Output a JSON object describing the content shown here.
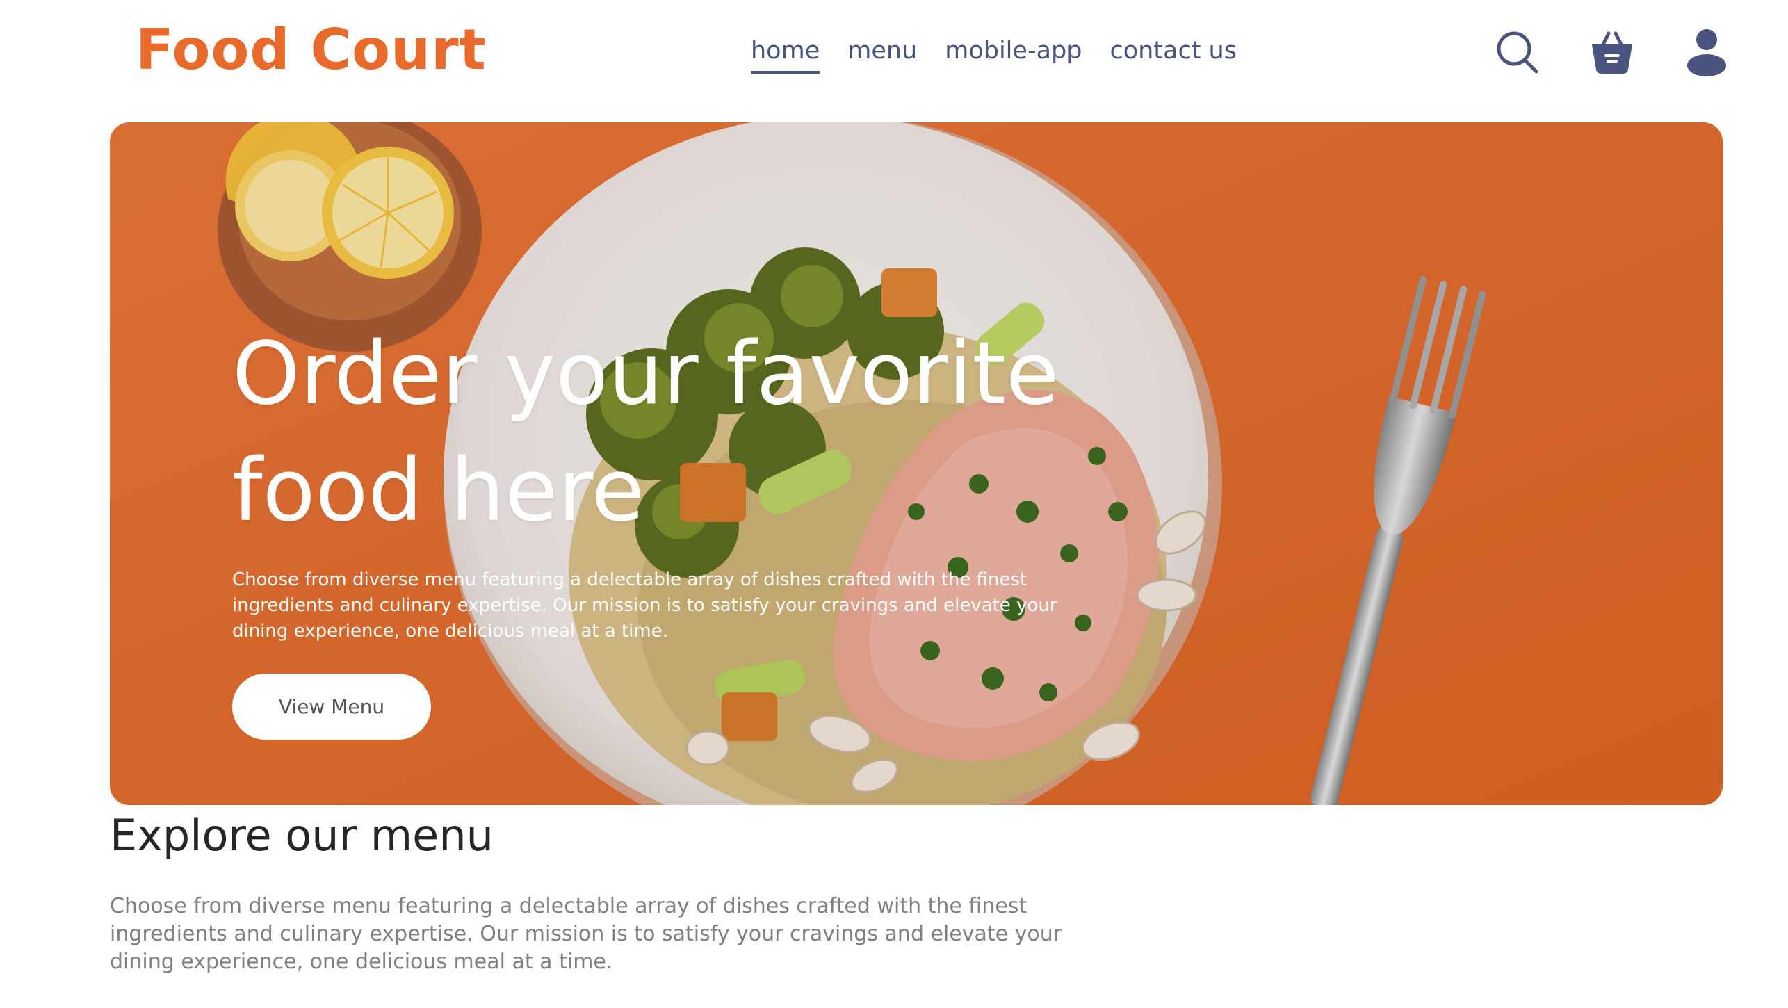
{
  "navbar": {
    "logo": "Food Court",
    "links": [
      {
        "label": "home",
        "active": true
      },
      {
        "label": "menu",
        "active": false
      },
      {
        "label": "mobile-app",
        "active": false
      },
      {
        "label": "contact us",
        "active": false
      }
    ],
    "icons": [
      "search-icon",
      "basket-icon",
      "profile-icon"
    ]
  },
  "hero": {
    "title": "Order your favorite food here",
    "text": "Choose from diverse menu featuring a delectable array of dishes crafted with the finest ingredients and culinary expertise. Our mission is to satisfy your cravings and elevate your dining experience, one delicious meal at a time.",
    "button_label": "View Menu"
  },
  "explore": {
    "title": "Explore our menu",
    "text": "Choose from diverse menu featuring a delectable array of dishes crafted with the finest ingredients and culinary expertise. Our mission is to satisfy your cravings and elevate your dining experience, one delicious meal at a time."
  },
  "colors": {
    "brand": "#e8692a",
    "nav_text": "#49557e",
    "hero_bg": "#e26a32",
    "heading": "#262626",
    "body_text": "#808080"
  }
}
